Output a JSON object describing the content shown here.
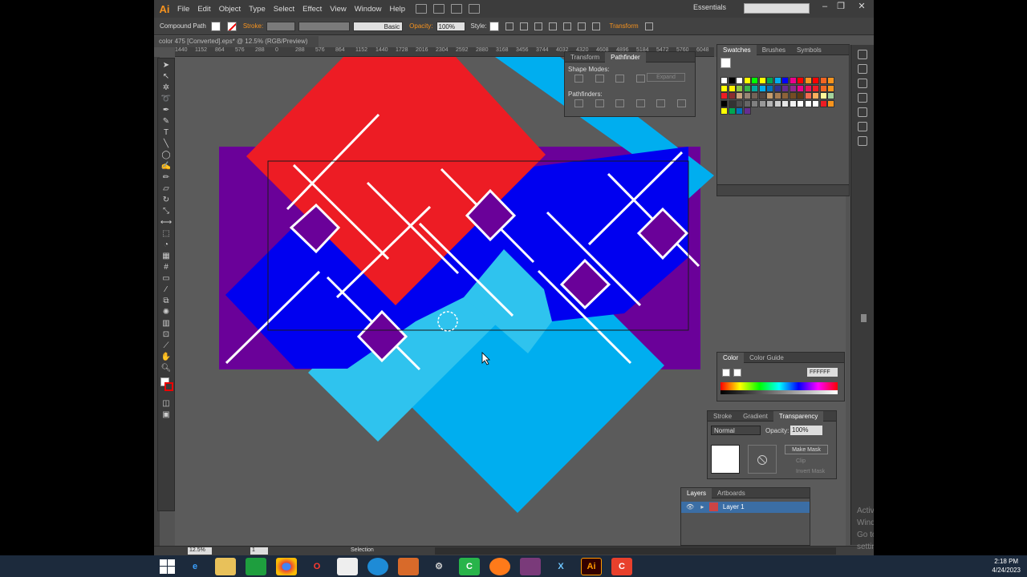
{
  "app": {
    "logo": "Ai",
    "menu": [
      "File",
      "Edit",
      "Object",
      "Type",
      "Select",
      "Effect",
      "View",
      "Window",
      "Help"
    ],
    "workspace": "Essentials",
    "window_controls": [
      "–",
      "❐",
      "✕"
    ]
  },
  "control_bar": {
    "selection_type": "Compound Path",
    "stroke_label": "Stroke:",
    "brush_label": "Basic",
    "opacity_label": "Opacity:",
    "opacity_value": "100%",
    "style_label": "Style:",
    "transform_label": "Transform"
  },
  "document": {
    "tab_title": "color 475 [Converted].eps* @ 12.5% (RGB/Preview)",
    "ruler_ticks": [
      "1440",
      "1152",
      "864",
      "576",
      "288",
      "0",
      "288",
      "576",
      "864",
      "1152",
      "1440",
      "1728",
      "2016",
      "2304",
      "2592",
      "2880",
      "3168",
      "3456",
      "3744",
      "4032",
      "4320",
      "4608",
      "4896",
      "5184",
      "5472",
      "5760",
      "6048"
    ]
  },
  "pathfinder_panel": {
    "tabs": [
      "Transform",
      "Pathfinder"
    ],
    "shape_modes_label": "Shape Modes:",
    "expand_label": "Expand",
    "pathfinders_label": "Pathfinders:"
  },
  "swatches_panel": {
    "tabs": [
      "Swatches",
      "Brushes",
      "Symbols"
    ],
    "colors": [
      "#ffffff",
      "#000000",
      "#ffffff",
      "#ffff00",
      "#00ff00",
      "#ffff00",
      "#00a651",
      "#00aeef",
      "#0000ff",
      "#ec008c",
      "#ff0000",
      "#f7941d",
      "#ff0000",
      "#f26522",
      "#f7941d",
      "#ffff00",
      "#fff200",
      "#8dc63f",
      "#39b54a",
      "#00a99d",
      "#00aeef",
      "#0072bc",
      "#2e3192",
      "#662d91",
      "#92278f",
      "#ec008c",
      "#ed145b",
      "#ed1c24",
      "#f26522",
      "#f7941d",
      "#ed1c24",
      "#8b2e2e",
      "#c7a27c",
      "#998675",
      "#736357",
      "#534741",
      "#c69c6d",
      "#a67c52",
      "#8c6239",
      "#754c24",
      "#603913",
      "#f26c4f",
      "#fbaf5d",
      "#fff799",
      "#a3d39c",
      "#000000",
      "#333333",
      "#4d4d4d",
      "#666666",
      "#808080",
      "#999999",
      "#b3b3b3",
      "#cccccc",
      "#e6e6e6",
      "#f2f2f2",
      "#ffffff",
      "#ffffff",
      "#ffffff",
      "#ed1c24",
      "#f7941d",
      "#ffff00",
      "#00a651",
      "#0072bc",
      "#662d91"
    ]
  },
  "color_panel": {
    "tabs": [
      "Color",
      "Color Guide"
    ],
    "hex_value": "FFFFFF"
  },
  "transparency_panel": {
    "tabs": [
      "Stroke",
      "Gradient",
      "Transparency"
    ],
    "blend_mode": "Normal",
    "opacity_label": "Opacity:",
    "opacity_value": "100%",
    "make_mask_label": "Make Mask",
    "clip_label": "Clip",
    "invert_mask_label": "Invert Mask"
  },
  "layers_panel": {
    "tabs": [
      "Layers",
      "Artboards"
    ],
    "layer_name": "Layer 1"
  },
  "status_bar": {
    "zoom": "12.5%",
    "artboard": "1",
    "tool": "Selection"
  },
  "watermark": {
    "line1": "Activate Windows",
    "line2": "Go to PC settings to activate Windows."
  },
  "taskbar": {
    "time": "2:18 PM",
    "date": "4/24/2023"
  },
  "artwork_colors": {
    "red": "#ed1c24",
    "cyan": "#00aeef",
    "light_cyan": "#2fc3ee",
    "blue": "#0000f0",
    "purple": "#6a0199"
  }
}
